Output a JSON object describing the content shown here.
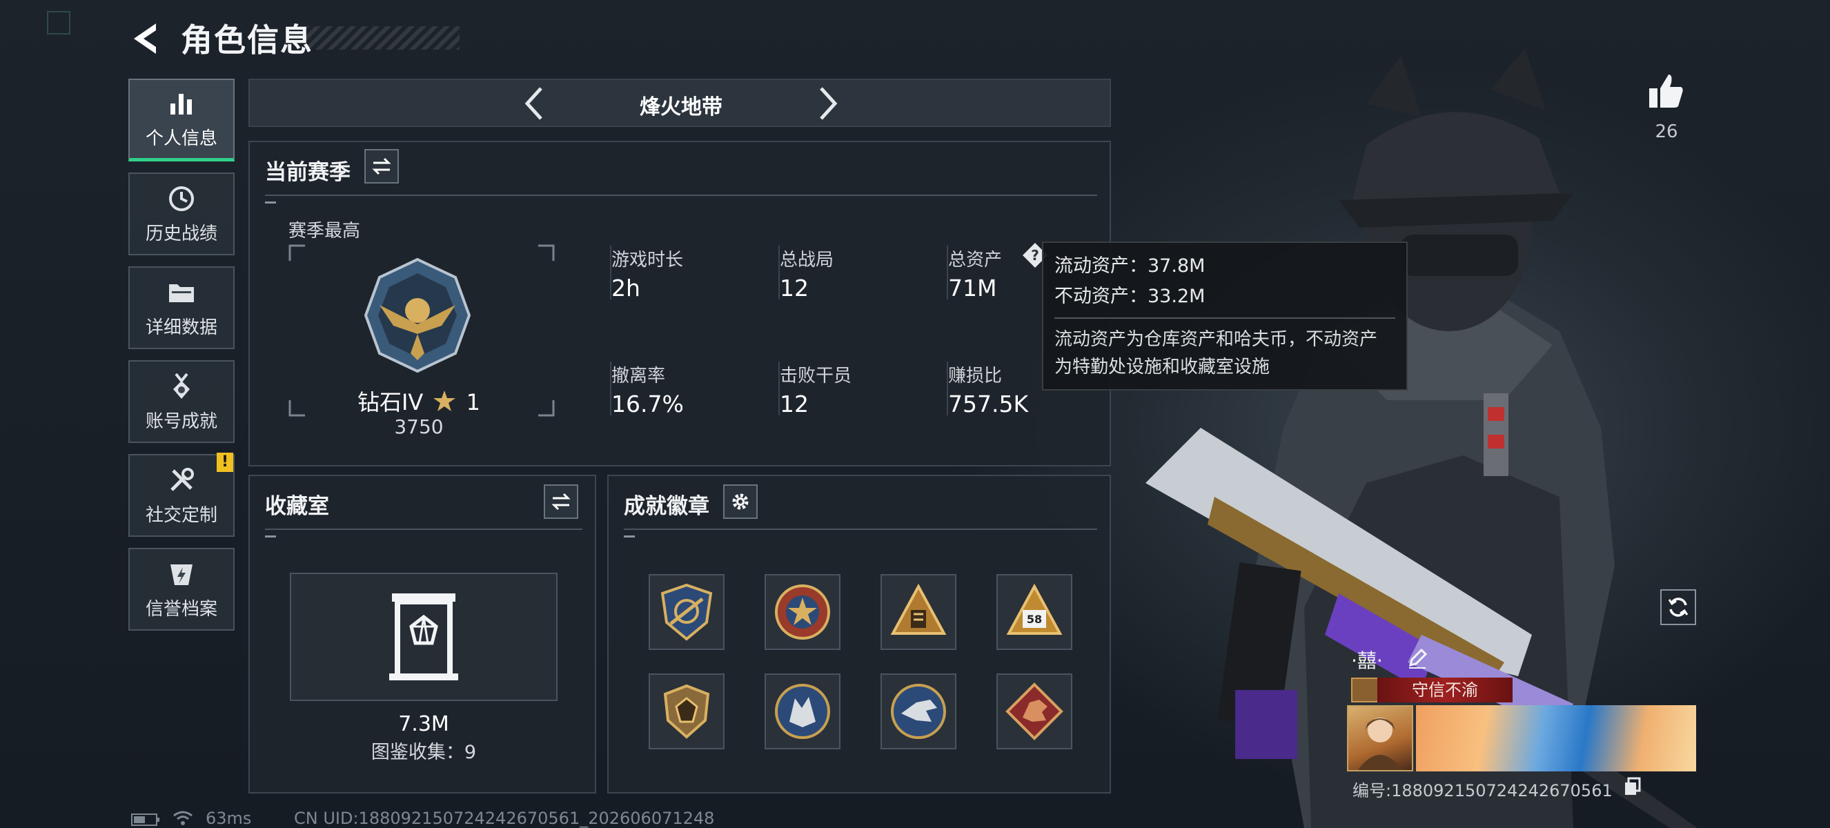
{
  "header": {
    "title": "角色信息"
  },
  "sidebar": {
    "items": [
      {
        "label": "个人信息",
        "active": true,
        "icon": "bar-chart-icon"
      },
      {
        "label": "历史战绩",
        "active": false,
        "icon": "history-clock-icon"
      },
      {
        "label": "详细数据",
        "active": false,
        "icon": "folder-icon"
      },
      {
        "label": "账号成就",
        "active": false,
        "icon": "medal-icon"
      },
      {
        "label": "社交定制",
        "active": false,
        "icon": "tools-icon",
        "badge": "!"
      },
      {
        "label": "信誉档案",
        "active": false,
        "icon": "lightning-shield-icon"
      }
    ]
  },
  "mode": {
    "title": "烽火地带"
  },
  "season": {
    "title": "当前赛季",
    "best_label": "赛季最高",
    "rank_name": "钻石IV",
    "rank_stars": "1",
    "rank_points": "3750",
    "stats": [
      {
        "label": "游戏时长",
        "value": "2h"
      },
      {
        "label": "总战局",
        "value": "12"
      },
      {
        "label": "总资产",
        "value": "71M",
        "help": true
      },
      {
        "label": "撤离率",
        "value": "16.7%"
      },
      {
        "label": "击败干员",
        "value": "12"
      },
      {
        "label": "赚损比",
        "value": "757.5K"
      }
    ]
  },
  "tooltip": {
    "liquid": "流动资产：37.8M",
    "fixed": "不动资产：33.2M",
    "desc_line1": "流动资产为仓库资产和哈夫币，不动资产",
    "desc_line2": "为特勤处设施和收藏室设施"
  },
  "collection": {
    "title": "收藏室",
    "value": "7.3M",
    "count_text": "图鉴收集：9"
  },
  "achievements": {
    "title": "成就徽章",
    "badges": [
      "shield-compass-badge",
      "star-roundel-badge",
      "pyramid-badge",
      "warning-58-badge",
      "gem-shield-badge",
      "wolf-roundel-badge",
      "eagle-roundel-badge",
      "dragon-diamond-badge"
    ]
  },
  "profile": {
    "likes": "26",
    "name": "·囍·",
    "title_badge": "守信不渝",
    "uid_text": "编号:188092150724242670561"
  },
  "footer": {
    "ping": "63ms",
    "uid_line": "CN UID:188092150724242670561_202606071248"
  },
  "colors": {
    "accent_green": "#2fd08a",
    "warning_yellow": "#f0c020",
    "title_red": "#8a1a1a"
  }
}
